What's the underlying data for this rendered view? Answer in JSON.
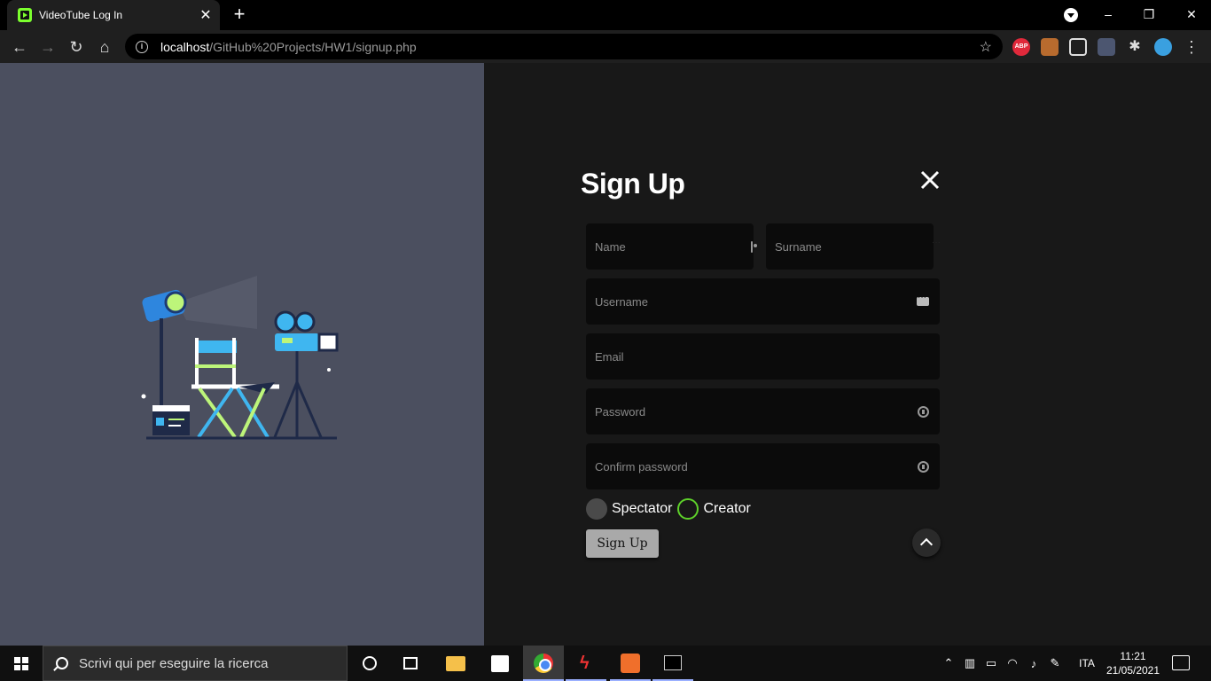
{
  "browser": {
    "tab_title": "VideoTube Log In",
    "tab_close": "✕",
    "new_tab": "+",
    "url_host": "localhost",
    "url_path": "/GitHub%20Projects/HW1/signup.php",
    "bookmark_icon": "star-icon",
    "extensions": [
      "adblock-plus-icon",
      "extension-icon",
      "extension-grid-icon",
      "extension-keyboard-icon",
      "extensions-puzzle-icon",
      "profile-avatar-icon",
      "menu-icon"
    ],
    "abp_label": "ABP"
  },
  "window": {
    "minimize": "–",
    "maximize": "❐",
    "close": "✕"
  },
  "signup": {
    "title": "Sign Up",
    "fields": {
      "name_placeholder": "Name",
      "surname_placeholder": "Surname",
      "username_placeholder": "Username",
      "email_placeholder": "Email",
      "password_placeholder": "Password",
      "confirm_placeholder": "Confirm password"
    },
    "roles": {
      "spectator": "Spectator",
      "creator": "Creator"
    },
    "submit_label": "Sign Up"
  },
  "colors": {
    "left_panel": "#4b4f5f",
    "page_bg": "#181818",
    "field_bg": "#0b0b0b",
    "creator_ring": "#5ed12a",
    "tab_favicon": "#7cff2e"
  },
  "taskbar": {
    "search_placeholder": "Scrivi qui per eseguire la ricerca",
    "language": "ITA",
    "time": "11:21",
    "date": "21/05/2021"
  }
}
